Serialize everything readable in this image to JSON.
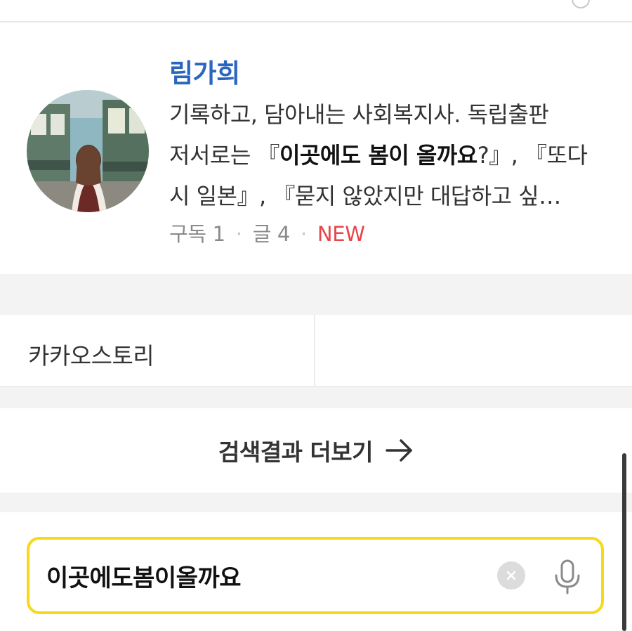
{
  "author": {
    "name": "림가희",
    "desc_line1": "기록하고, 담아내는 사회복지사. 독립출판",
    "desc_line2_prefix": "저서로는 『",
    "desc_line2_bold": "이곳에도 봄이 올까요",
    "desc_line2_suffix": "?』, 『또다",
    "desc_line3": "시 일본』, 『묻지 않았지만 대답하고 싶…",
    "meta": {
      "subscribe_label": "구독 1",
      "separator": "·",
      "posts_label": "글 4",
      "new_badge": "NEW"
    }
  },
  "story": {
    "label": "카카오스토리"
  },
  "more": {
    "label": "검색결과 더보기"
  },
  "search": {
    "value": "이곳에도봄이올까요",
    "border_color": "#f7d917"
  },
  "colors": {
    "author_name": "#2a66c0",
    "new_badge": "#e6454a"
  },
  "icons": {
    "avatar": "profile-photo",
    "more_arrow": "arrow-right-icon",
    "clear": "clear-icon",
    "mic": "microphone-icon"
  }
}
